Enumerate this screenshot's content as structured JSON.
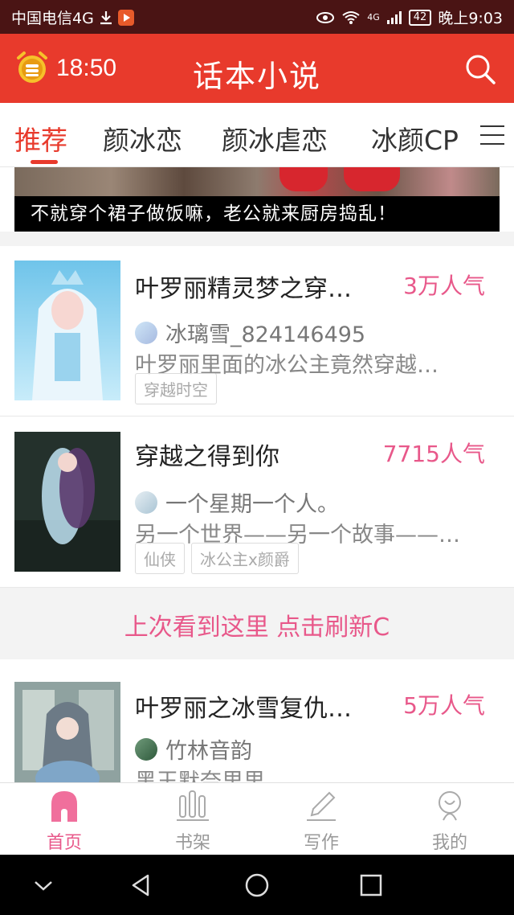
{
  "status_bar": {
    "carrier": "中国电信4G",
    "network": "4G",
    "battery": "42",
    "time": "晚上9:03"
  },
  "app_bar": {
    "timer": "18:50",
    "title": "话本小说"
  },
  "tabs": [
    {
      "label": "推荐",
      "active": true
    },
    {
      "label": "颜冰恋",
      "active": false
    },
    {
      "label": "颜冰虐恋",
      "active": false
    },
    {
      "label": "冰颜CP",
      "active": false
    }
  ],
  "banner": {
    "caption": "不就穿个裙子做饭嘛，老公就来厨房捣乱！"
  },
  "novels": [
    {
      "title": "叶罗丽精灵梦之穿…",
      "popularity": "3万人气",
      "author": "冰璃雪_824146495",
      "description": "叶罗丽里面的冰公主竟然穿越…",
      "tags": [
        "穿越时空"
      ]
    },
    {
      "title": "穿越之得到你",
      "popularity": "7715人气",
      "author": "一个星期一个人。",
      "description": "另一个世界——另一个故事——…",
      "tags": [
        "仙侠",
        "冰公主x颜爵"
      ]
    },
    {
      "title": "叶罗丽之冰雪复仇…",
      "popularity": "5万人气",
      "author": "竹林音韵",
      "description": "黑王默奈里里",
      "tags": []
    }
  ],
  "refresh_bar": {
    "text": "上次看到这里 点击刷新C"
  },
  "bottom_nav": [
    {
      "label": "首页",
      "icon": "home-icon",
      "active": true
    },
    {
      "label": "书架",
      "icon": "bookshelf-icon",
      "active": false
    },
    {
      "label": "写作",
      "icon": "pencil-icon",
      "active": false
    },
    {
      "label": "我的",
      "icon": "profile-icon",
      "active": false
    }
  ],
  "colors": {
    "primary_red": "#e83a2c",
    "accent_pink": "#e8588a",
    "status_bar_bg": "#4a1414"
  }
}
